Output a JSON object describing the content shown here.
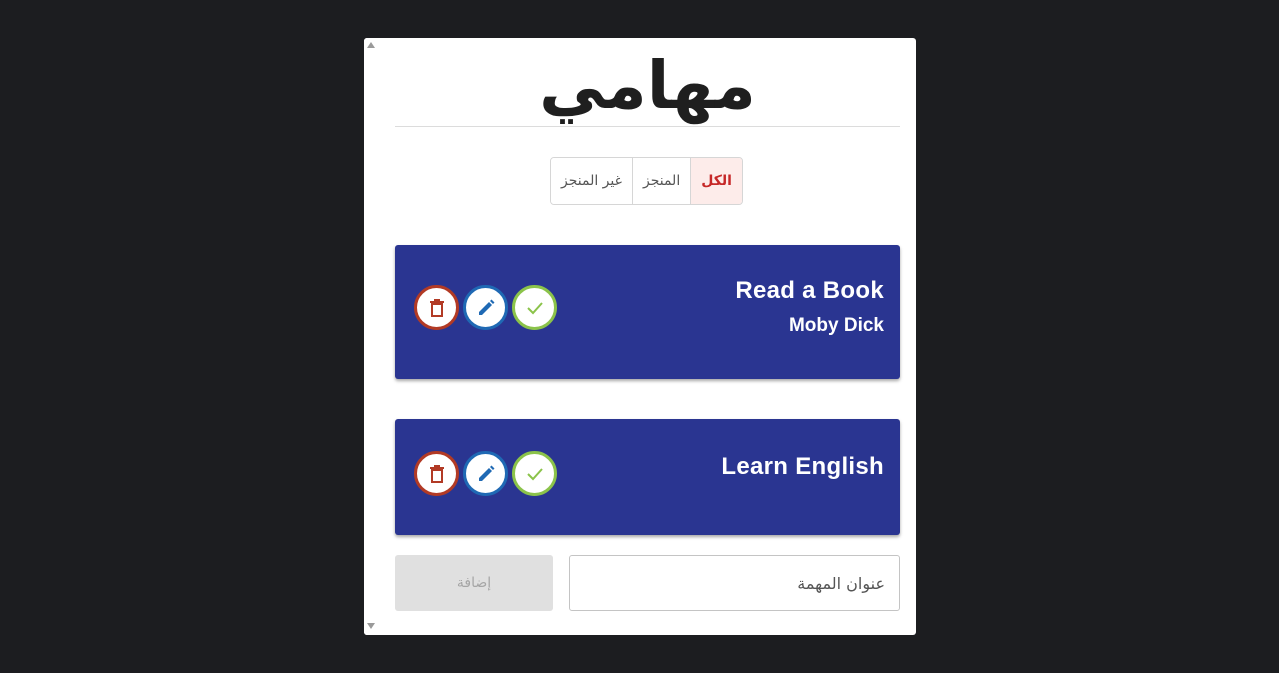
{
  "page": {
    "title": "مهامي"
  },
  "filters": [
    {
      "label": "الكل",
      "active": true
    },
    {
      "label": "المنجز",
      "active": false
    },
    {
      "label": "غير المنجز",
      "active": false
    }
  ],
  "todos": [
    {
      "title": "Read a Book",
      "description": "Moby Dick"
    },
    {
      "title": "Learn English",
      "description": ""
    }
  ],
  "actions": {
    "delete_icon": "trash-icon",
    "edit_icon": "pencil-icon",
    "done_icon": "check-icon"
  },
  "add_form": {
    "input_placeholder": "عنوان المهمة",
    "input_value": "",
    "button_label": "إضافة",
    "button_disabled": true
  },
  "colors": {
    "background": "#1c1d20",
    "card": "#ffffff",
    "todo_card": "#2a3591",
    "delete": "#b23a25",
    "edit": "#1f69b4",
    "done": "#8bc34a",
    "active_filter_text": "#c62828"
  }
}
